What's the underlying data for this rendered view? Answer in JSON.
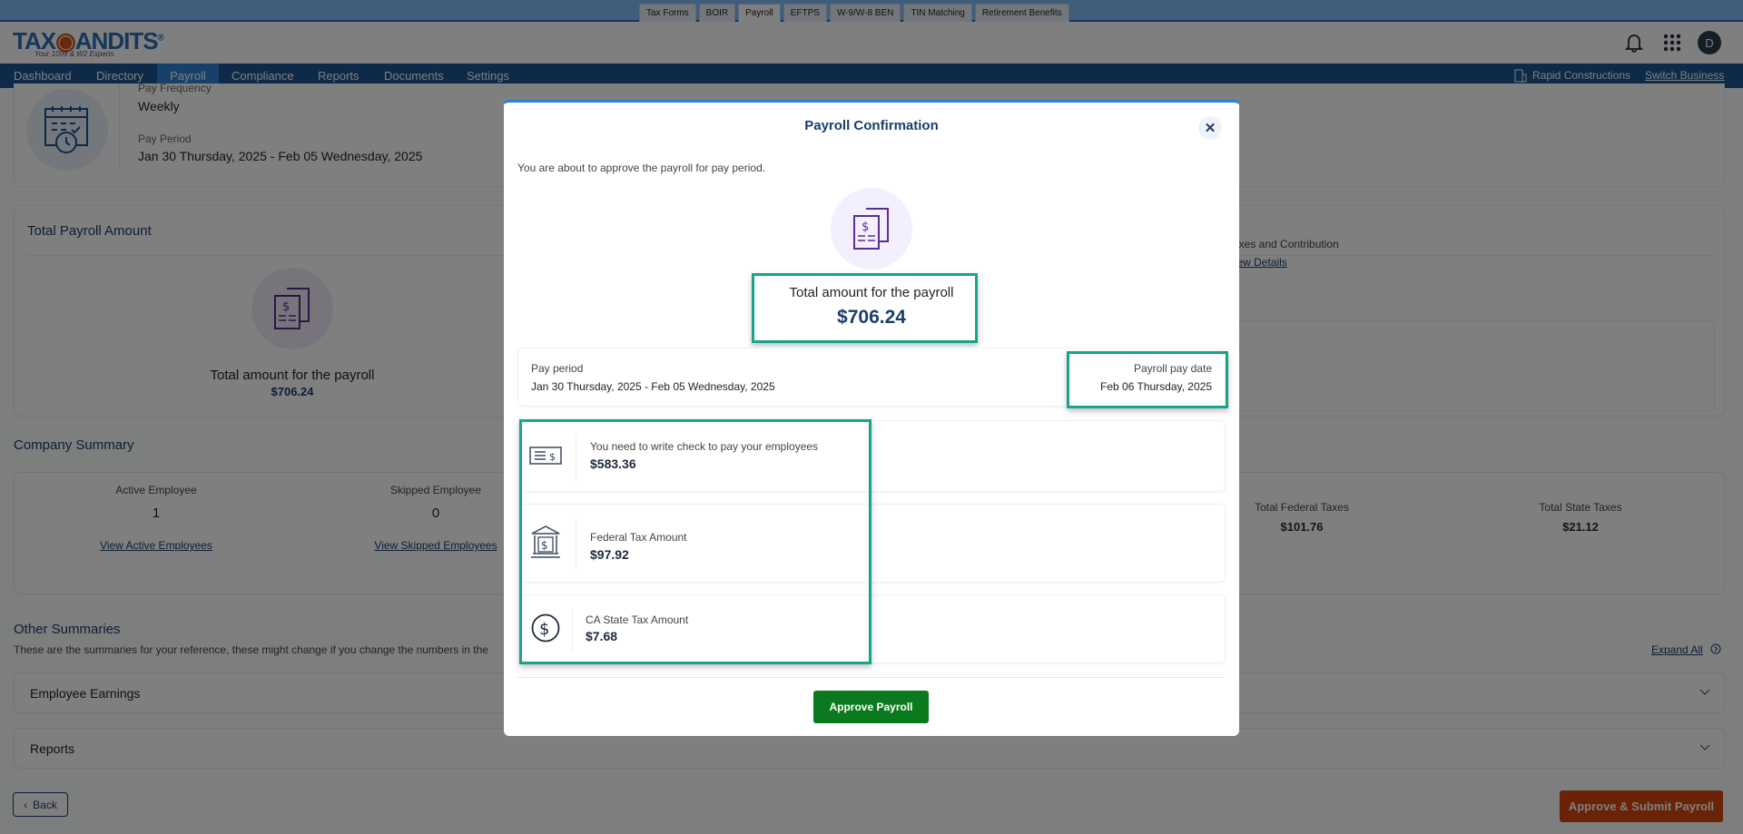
{
  "top_tabs": [
    {
      "label": "Tax Forms"
    },
    {
      "label": "BOIR"
    },
    {
      "label": "Payroll",
      "active": true
    },
    {
      "label": "EFTPS"
    },
    {
      "label": "W-9/W-8 BEN"
    },
    {
      "label": "TIN Matching"
    },
    {
      "label": "Retirement Benefits"
    }
  ],
  "logo": {
    "text_left": "TAX",
    "text_right": "ANDITS",
    "tagline": "Your 1099 & W2 Experts"
  },
  "header": {
    "avatar_initial": "D"
  },
  "nav": {
    "items": [
      {
        "label": "Dashboard"
      },
      {
        "label": "Directory"
      },
      {
        "label": "Payroll",
        "active": true
      },
      {
        "label": "Compliance"
      },
      {
        "label": "Reports"
      },
      {
        "label": "Documents"
      },
      {
        "label": "Settings"
      }
    ],
    "business": "Rapid Constructions",
    "switch": "Switch Business"
  },
  "pay_info": {
    "freq_label": "Pay Frequency",
    "freq_value": "Weekly",
    "period_label": "Pay Period",
    "period_value": "Jan 30 Thursday, 2025 - Feb 05 Wednesday, 2025"
  },
  "total_payroll": {
    "title": "Total Payroll Amount",
    "label": "Total amount for the payroll",
    "amount": "$706.24",
    "taxes_label": "Taxes and Contribution",
    "view_details": "View Details"
  },
  "company_summary": {
    "title": "Company Summary",
    "active_label": "Active Employee",
    "active_value": "1",
    "active_link": "View Active Employees",
    "skipped_label": "Skipped Employee",
    "skipped_value": "0",
    "skipped_link": "View Skipped Employees",
    "federal_label": "Total Federal Taxes",
    "federal_value": "$101.76",
    "state_label": "Total State Taxes",
    "state_value": "$21.12"
  },
  "other": {
    "title": "Other Summaries",
    "desc": "These are the summaries for your reference, these might change if you change the numbers in the",
    "expand_all": "Expand All",
    "sections": [
      {
        "label": "Employee Earnings"
      },
      {
        "label": "Reports"
      }
    ]
  },
  "footer": {
    "back": "Back",
    "submit": "Approve & Submit Payroll"
  },
  "modal": {
    "title": "Payroll Confirmation",
    "subtitle": "You are about to approve the payroll for pay period.",
    "total_label": "Total amount for the payroll",
    "total_amount": "$706.24",
    "pay_period_label": "Pay period",
    "pay_period_value": "Jan 30 Thursday, 2025 - Feb 05 Wednesday, 2025",
    "pay_date_label": "Payroll pay date",
    "pay_date_value": "Feb 06 Thursday, 2025",
    "items": [
      {
        "label": "You need to write check to pay your employees",
        "amount": "$583.36",
        "icon": "check-icon"
      },
      {
        "label": "Federal Tax Amount",
        "amount": "$97.92",
        "icon": "bank-icon"
      },
      {
        "label": "CA State Tax Amount",
        "amount": "$7.68",
        "icon": "dollar-circle-icon"
      }
    ],
    "approve": "Approve Payroll"
  },
  "colors": {
    "accent": "#2b7fd4",
    "nav": "#1b5490",
    "highlight": "#17a589",
    "approve": "#0b7a1e",
    "submit": "#d5460c"
  }
}
